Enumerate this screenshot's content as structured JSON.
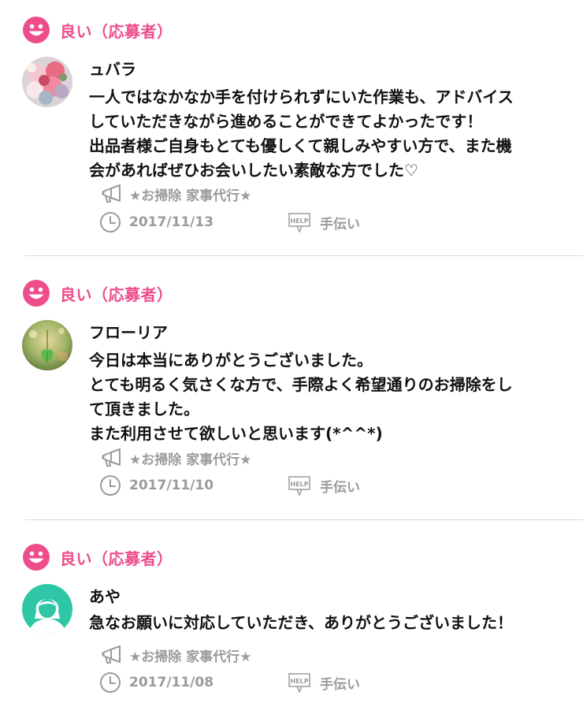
{
  "colors": {
    "accent": "#ee4d8c",
    "meta_gray": "#9b9b9b",
    "divider": "#dcdcdc",
    "avatar_teal": "#2ec7a6"
  },
  "reviews": [
    {
      "rating": "良い（応募者）",
      "rating_icon": "smile-face-icon",
      "username": "ュバラ",
      "avatar": "flower-bouquet-photo",
      "comment_lines": [
        "一人ではなかなか手を付けられずにいた作業も、アドバイス",
        "していただきながら進めることができてよかったです！",
        "出品者様ご自身もとても優しくて親しみやすい方で、また機",
        "会があればぜひお会いしたい素敵な方でした♡"
      ],
      "category": "★お掃除 家事代行★",
      "category_icon": "megaphone-icon",
      "date": "2017/11/13",
      "date_icon": "clock-icon",
      "type": "手伝い",
      "type_icon": "help-sign-icon"
    },
    {
      "rating": "良い（応募者）",
      "rating_icon": "smile-face-icon",
      "username": "フローリア",
      "avatar": "green-leaf-photo",
      "comment_lines": [
        "今日は本当にありがとうございました。",
        "とても明るく気さくな方で、手際よく希望通りのお掃除をし",
        "て頂きました。",
        "また利用させて欲しいと思います(*^^*)"
      ],
      "category": "★お掃除 家事代行★",
      "category_icon": "megaphone-icon",
      "date": "2017/11/10",
      "date_icon": "clock-icon",
      "type": "手伝い",
      "type_icon": "help-sign-icon"
    },
    {
      "rating": "良い（応募者）",
      "rating_icon": "smile-face-icon",
      "username": "あや",
      "avatar": "default-female-avatar",
      "comment_lines": [
        "急なお願いに対応していただき、ありがとうございました！"
      ],
      "category": "★お掃除 家事代行★",
      "category_icon": "megaphone-icon",
      "date": "2017/11/08",
      "date_icon": "clock-icon",
      "type": "手伝い",
      "type_icon": "help-sign-icon"
    }
  ]
}
